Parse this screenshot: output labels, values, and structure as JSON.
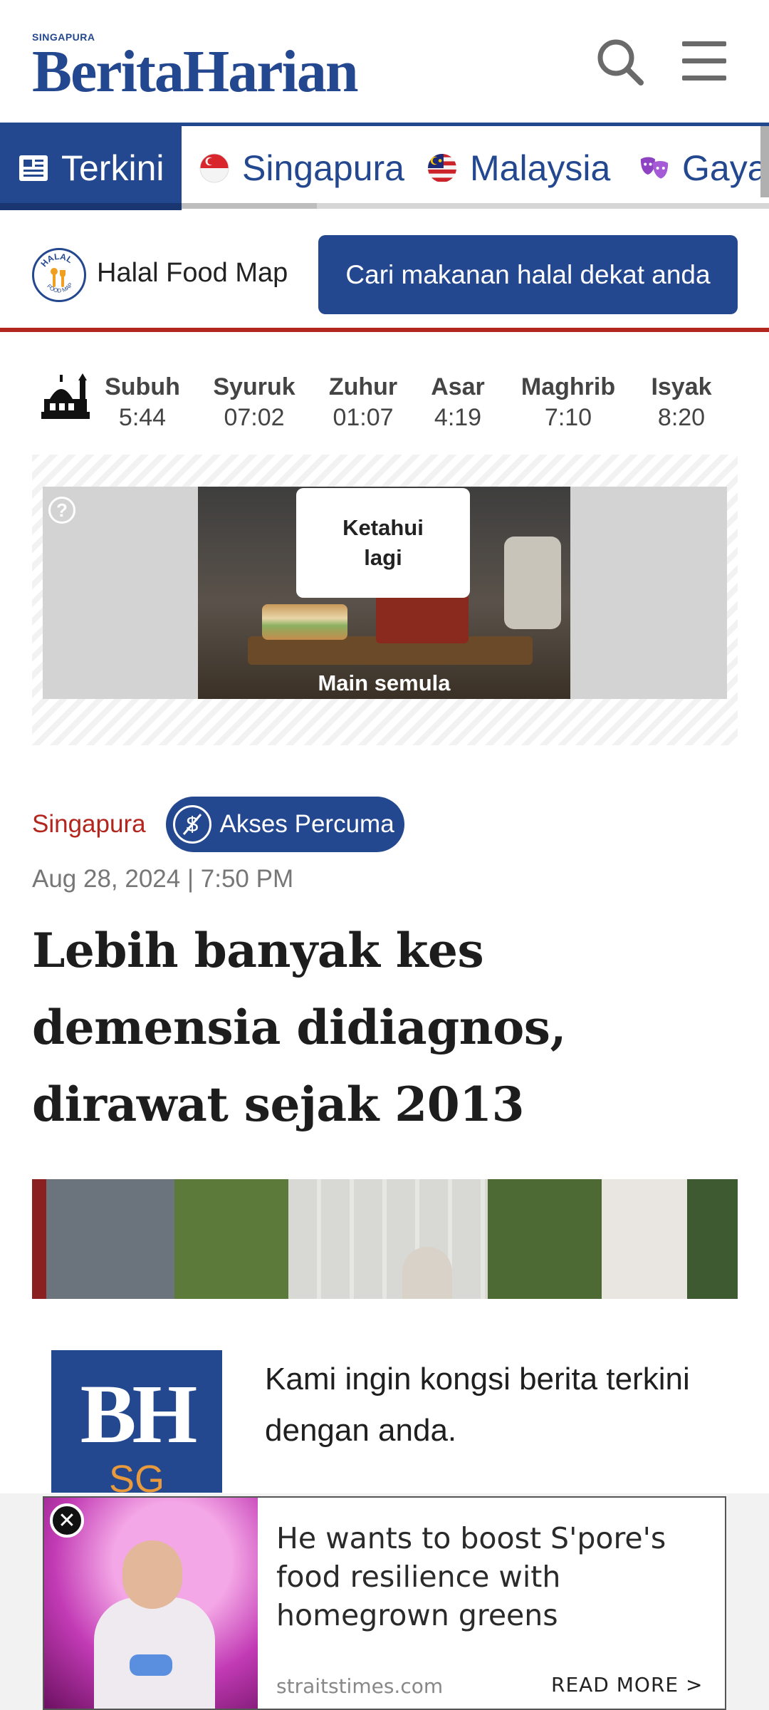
{
  "header": {
    "logo_small": "SINGAPURA",
    "logo_main": "BeritaHarian"
  },
  "nav": {
    "tabs": [
      {
        "label": "Terkini",
        "icon": "newspaper-icon",
        "active": true
      },
      {
        "label": "Singapura",
        "icon": "singapore-flag-icon",
        "active": false
      },
      {
        "label": "Malaysia",
        "icon": "malaysia-flag-icon",
        "active": false
      },
      {
        "label": "Gaya",
        "icon": "theatre-masks-icon",
        "active": false
      }
    ]
  },
  "halal": {
    "label": "Halal Food Map",
    "button": "Cari makanan halal dekat anda"
  },
  "prayer": [
    {
      "name": "Subuh",
      "time": "5:44"
    },
    {
      "name": "Syuruk",
      "time": "07:02"
    },
    {
      "name": "Zuhur",
      "time": "01:07"
    },
    {
      "name": "Asar",
      "time": "4:19"
    },
    {
      "name": "Maghrib",
      "time": "7:10"
    },
    {
      "name": "Isyak",
      "time": "8:20"
    }
  ],
  "ad": {
    "help": "?",
    "learn_more": "Ketahui lagi",
    "replay": "Main semula"
  },
  "article": {
    "section": "Singapura",
    "access": "Akses Percuma",
    "date": "Aug 28, 2024 | 7:50 PM",
    "title": "Lebih banyak kes demensia didiagnos, dirawat sejak 2013"
  },
  "promo": {
    "logo_bh": "BH",
    "logo_sg": "SG",
    "text": "Kami ingin kongsi berita terkini dengan anda."
  },
  "bottom_ad": {
    "headline": "He wants to boost S'pore's food resilience with homegrown greens",
    "source": "straitstimes.com",
    "read_more": "READ MORE >",
    "close": "✕"
  },
  "colors": {
    "brand_blue": "#24488f",
    "accent_red": "#b3261e"
  }
}
